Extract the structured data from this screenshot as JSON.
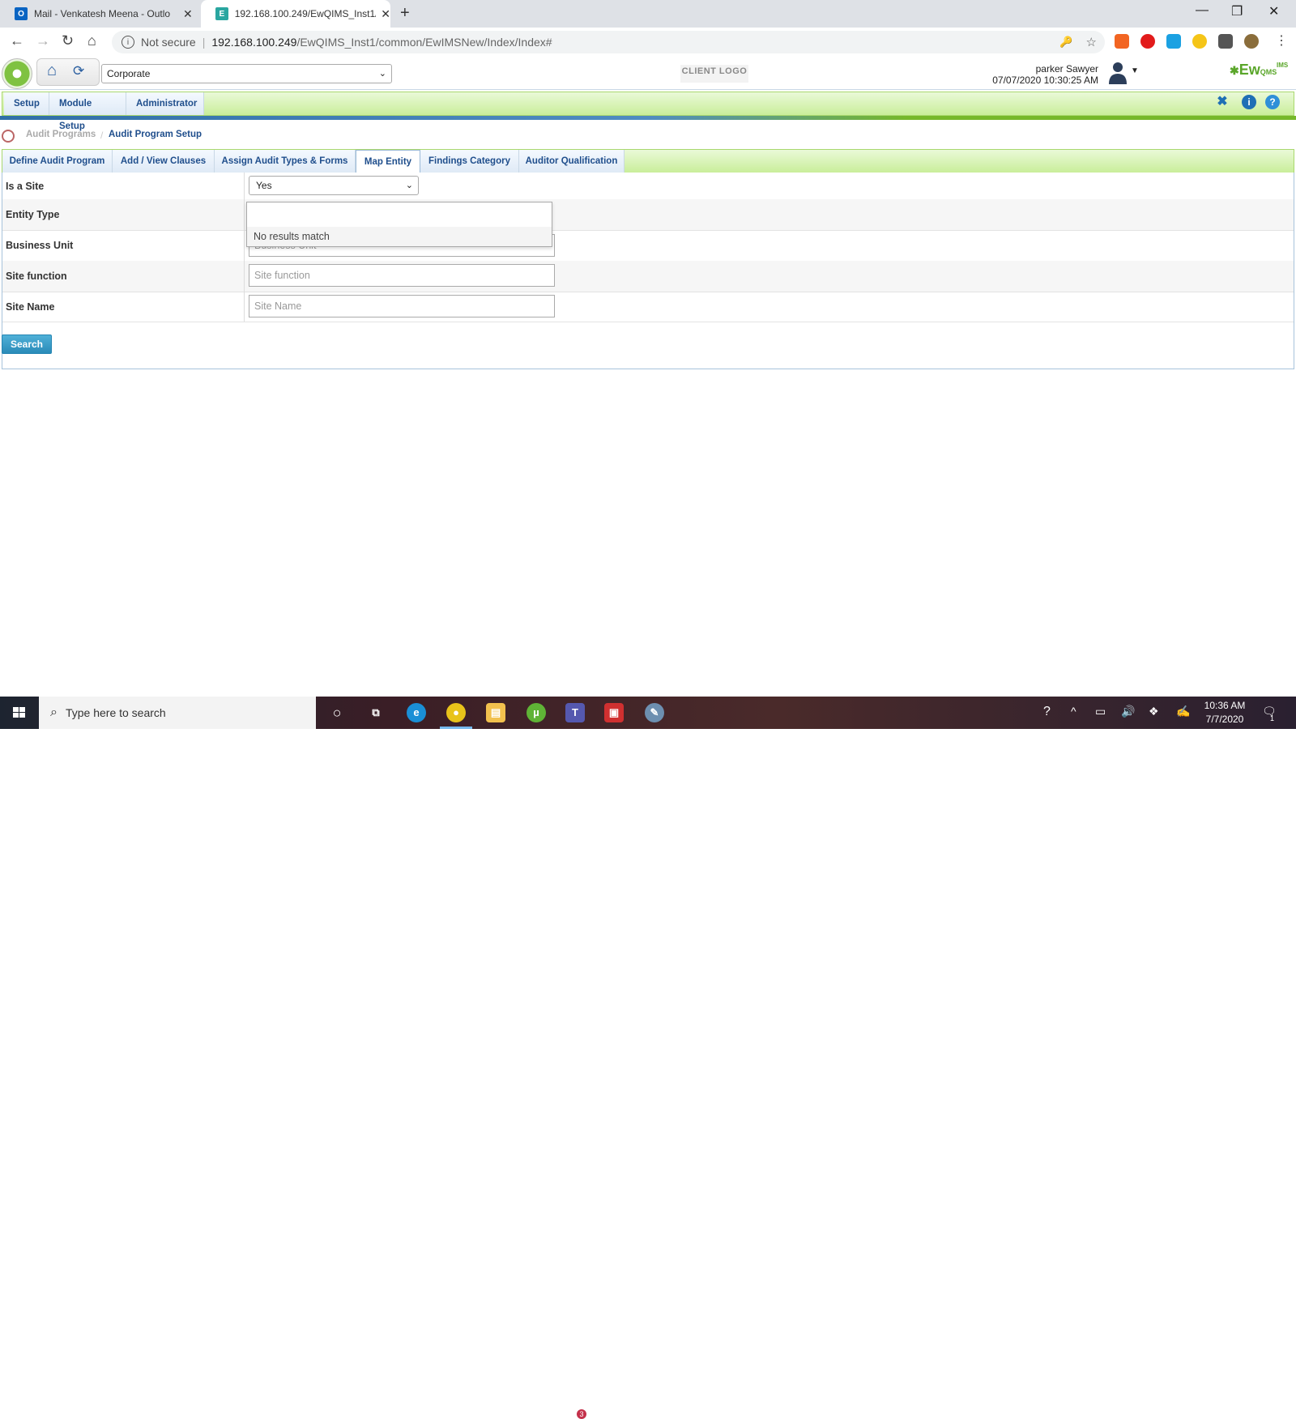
{
  "browser": {
    "tabs": [
      {
        "label": "Mail - Venkatesh Meena - Outlo",
        "icon": "outlook-icon"
      },
      {
        "label": "192.168.100.249/EwQIMS_Inst1/c",
        "icon": "ewqims-favicon-icon"
      }
    ],
    "address": {
      "security": "Not secure",
      "host": "192.168.100.249",
      "path": "/EwQIMS_Inst1/common/EwIMSNew/Index/Index#"
    }
  },
  "header": {
    "organization_select": "Corporate",
    "client_logo": "CLIENT LOGO",
    "user_name": "parker Sawyer",
    "datetime": "07/07/2020 10:30:25 AM",
    "brand": "Ew",
    "brand_sub": "IMS",
    "brand_qms": "QMS"
  },
  "menu": {
    "items": [
      "Setup",
      "Module Setup",
      "Administrator"
    ]
  },
  "breadcrumb": {
    "parent": "Audit Programs",
    "current": "Audit Program Setup"
  },
  "tabs": [
    "Define Audit Program",
    "Add / View Clauses",
    "Assign Audit Types & Forms",
    "Map Entity",
    "Findings Category",
    "Auditor Qualification"
  ],
  "active_tab": "Map Entity",
  "form": {
    "is_site": {
      "label": "Is a Site",
      "value": "Yes"
    },
    "entity_type": {
      "label": "Entity Type",
      "no_results": "No results match"
    },
    "business_unit": {
      "label": "Business Unit",
      "placeholder": "Business Unit"
    },
    "site_function": {
      "label": "Site function",
      "placeholder": "Site function"
    },
    "site_name": {
      "label": "Site Name",
      "placeholder": "Site Name"
    },
    "search_button": "Search"
  },
  "taskbar": {
    "search_placeholder": "Type here to search",
    "time": "10:36 AM",
    "date": "7/7/2020",
    "teams_badge": "3",
    "notification_count": "1"
  },
  "colors": {
    "menu_green": "#c9ee9a",
    "link_blue": "#1f4e8c",
    "search_button": "#2a8bb8"
  }
}
